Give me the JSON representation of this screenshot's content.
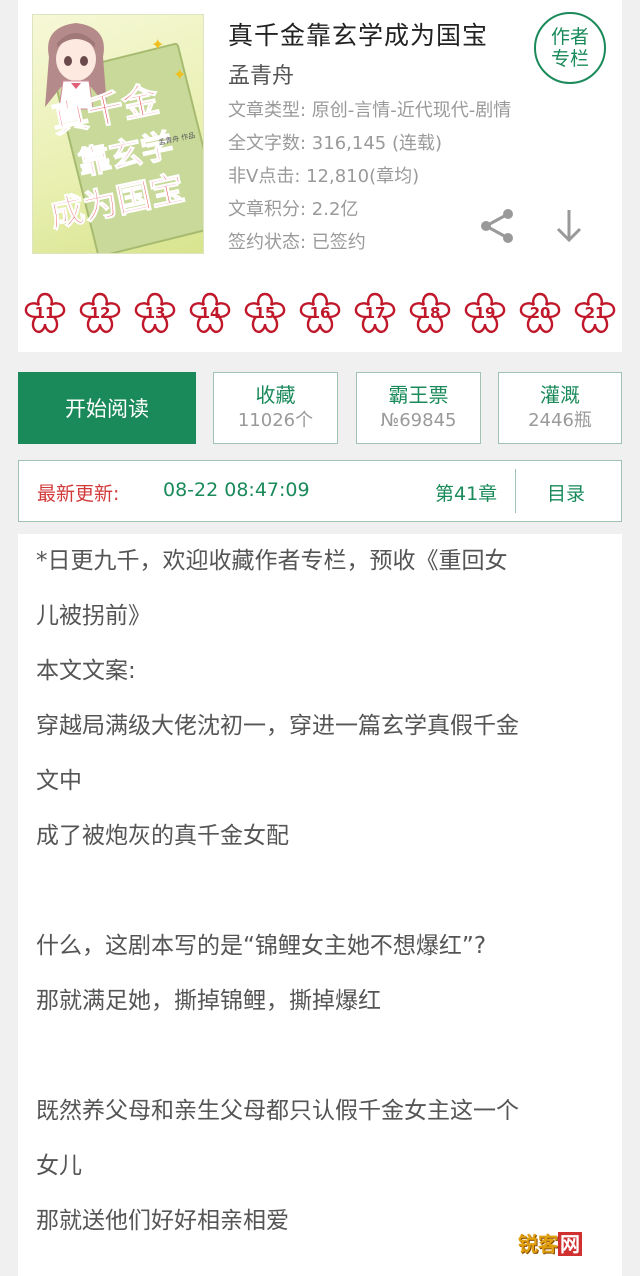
{
  "book": {
    "title": "真千金靠玄学成为国宝",
    "author": "孟青舟",
    "meta": [
      "文章类型: 原创-言情-近代现代-剧情",
      "全文字数: 316,145 (连载)",
      "非V点击: 12,810(章均)",
      "文章积分: 2.2亿",
      "签约状态:  已签约"
    ],
    "author_column_line1": "作者",
    "author_column_line2": "专栏",
    "cover_title_line1": "真千金",
    "cover_title_line2": "靠玄学",
    "cover_title_line3": "成为国宝",
    "cover_author_small": "孟青舟 作品"
  },
  "flowers": [
    "11",
    "12",
    "13",
    "14",
    "15",
    "16",
    "17",
    "18",
    "19",
    "20",
    "21"
  ],
  "actions": {
    "read_label": "开始阅读",
    "favorite_label": "收藏",
    "favorite_value": "11026个",
    "bawang_label": "霸王票",
    "bawang_value": "№69845",
    "nutrient_label": "灌溉",
    "nutrient_value": "2446瓶"
  },
  "update": {
    "label": "最新更新:",
    "time": "08-22 08:47:09",
    "chapter": "第41章",
    "toc_label": "目录"
  },
  "content": [
    "*日更九千，欢迎收藏作者专栏，预收《重回女",
    "儿被拐前》",
    "本文文案:",
    "穿越局满级大佬沈初一，穿进一篇玄学真假千金",
    "文中",
    "成了被炮灰的真千金女配",
    "",
    "什么，这剧本写的是“锦鲤女主她不想爆红”?",
    "那就满足她，撕掉锦鲤，撕掉爆红",
    "",
    "既然养父母和亲生父母都只认假千金女主这一个",
    "女儿",
    "那就送他们好好相亲相爱"
  ],
  "watermark": {
    "part1": "锐客",
    "part2": "网"
  },
  "colors": {
    "brand_green": "#1a8a5a",
    "update_red": "#d23a3a",
    "flower_red": "#c0182a"
  }
}
